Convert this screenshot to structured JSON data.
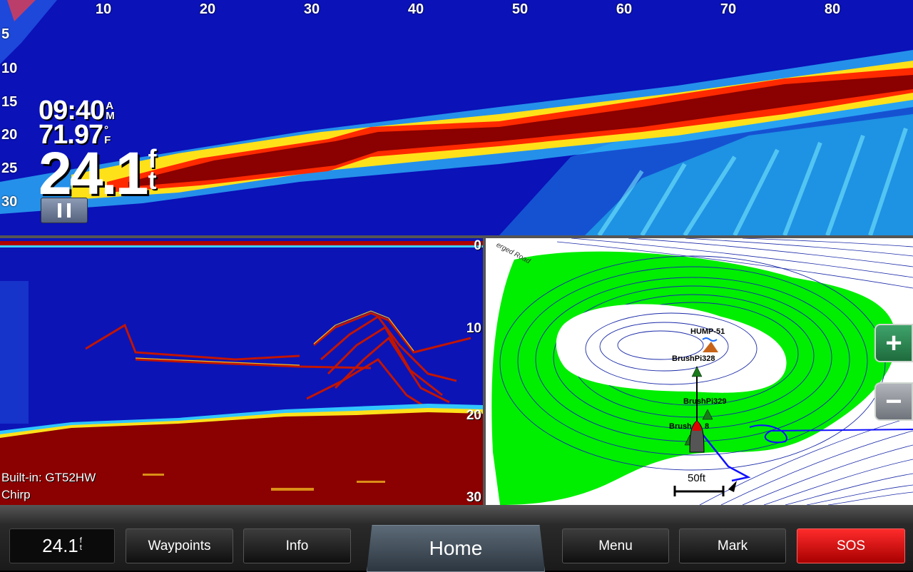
{
  "livescope": {
    "range_ticks": [
      "10",
      "20",
      "30",
      "40",
      "50",
      "60",
      "70",
      "80"
    ],
    "depth_ticks": [
      "5",
      "10",
      "15",
      "20",
      "25",
      "30"
    ],
    "time": "09:40",
    "time_suffix": [
      "A",
      "M"
    ],
    "temperature": "71.97",
    "temp_unit": [
      "°",
      "F"
    ],
    "depth": "24.1",
    "depth_unit": [
      "f",
      "t"
    ],
    "pause_icon": "pause-icon"
  },
  "sonar": {
    "depth_ticks": [
      "0",
      "10",
      "20",
      "30"
    ],
    "transducer": "Built-in: GT52HW",
    "mode": "Chirp"
  },
  "chart": {
    "road_label": "erged Road",
    "waypoints": [
      {
        "label": "HUMP-51"
      },
      {
        "label": "BrushPi328"
      },
      {
        "label": "BrushPi329"
      },
      {
        "label": "Brush"
      },
      {
        "label": "8"
      }
    ],
    "scale": "50ft",
    "zoom_in": "+",
    "zoom_out": "−",
    "colors": {
      "shallow": "#00ee00",
      "contour": "#1a2aa8",
      "track": "#1010ff"
    }
  },
  "toolbar": {
    "depth_value": "24.1",
    "depth_unit": [
      "f",
      "t"
    ],
    "waypoints": "Waypoints",
    "info": "Info",
    "home": "Home",
    "menu": "Menu",
    "mark": "Mark",
    "sos": "SOS",
    "sos_color": "#e00000"
  }
}
